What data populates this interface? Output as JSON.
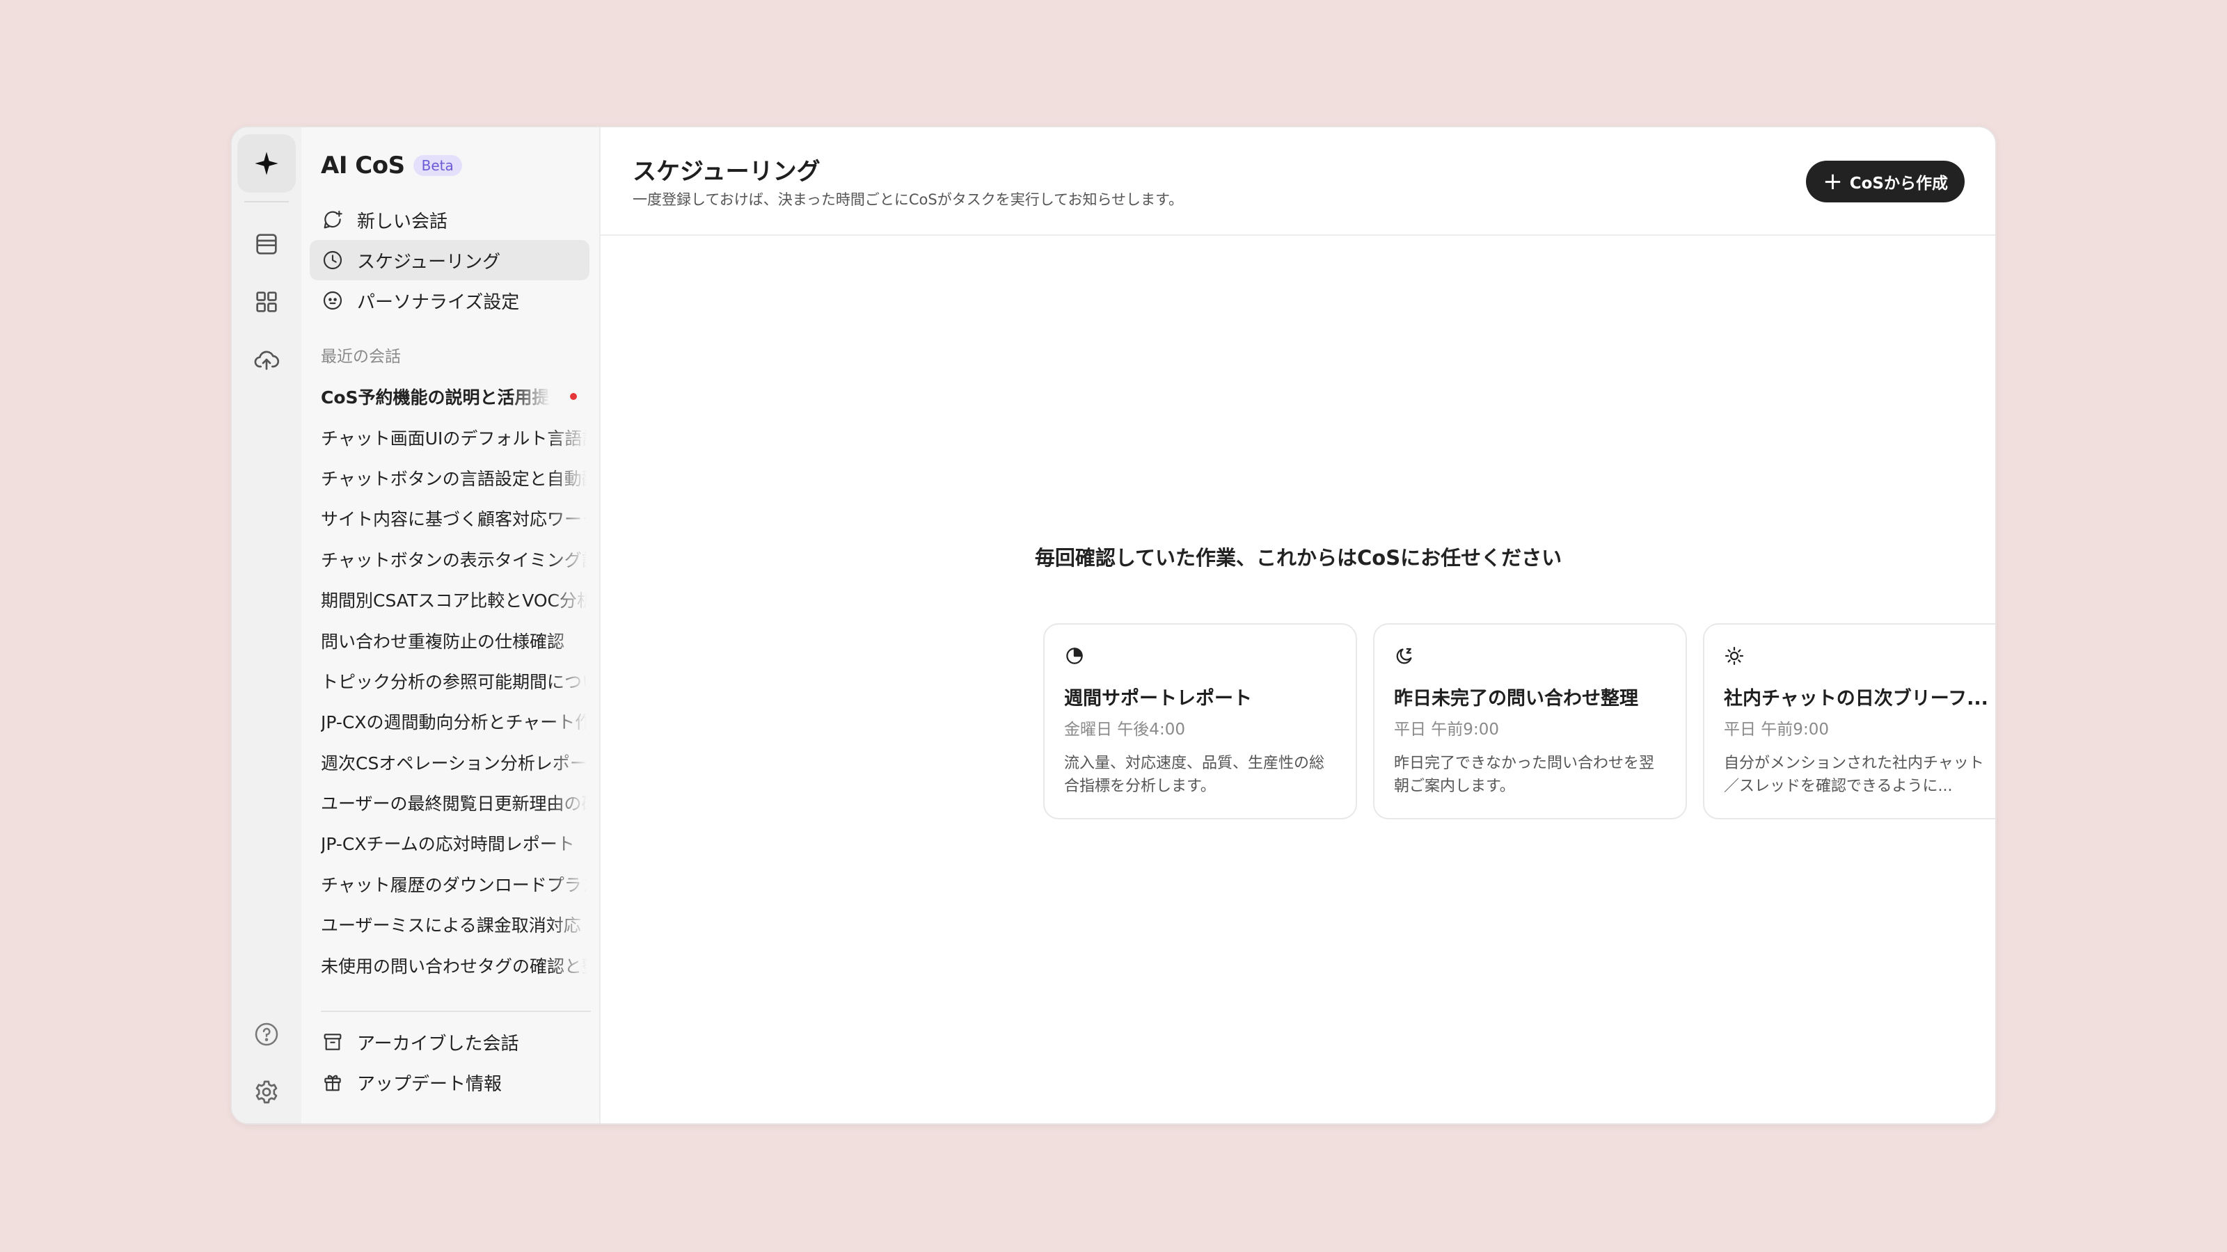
{
  "app": {
    "title": "AI CoS",
    "badge": "Beta"
  },
  "rail": {
    "icons": [
      "sparkle-icon",
      "inbox-icon",
      "grid-icon",
      "cloud-upload-icon",
      "help-icon",
      "settings-icon"
    ]
  },
  "sidebar": {
    "nav": [
      {
        "label": "新しい会話",
        "icon": "chat-plus-icon"
      },
      {
        "label": "スケジューリング",
        "icon": "clock-icon"
      },
      {
        "label": "パーソナライズ設定",
        "icon": "smiley-icon"
      }
    ],
    "recent_label": "最近の会話",
    "conversations": [
      "CoS予約機能の説明と活用提案",
      "チャット画面UIのデフォルト言語設定",
      "チャットボタンの言語設定と自動翻訳",
      "サイト内容に基づく顧客対応ワークフロー",
      "チャットボタンの表示タイミング設定",
      "期間別CSATスコア比較とVOC分析",
      "問い合わせ重複防止の仕様確認",
      "トピック分析の参照可能期間について",
      "JP-CXの週間動向分析とチャート作成",
      "週次CSオペレーション分析レポート",
      "ユーザーの最終閲覧日更新理由の確認",
      "JP-CXチームの応対時間レポート",
      "チャット履歴のダウンロードプラン",
      "ユーザーミスによる課金取消対応",
      "未使用の問い合わせタグの確認と整理"
    ],
    "footer": [
      {
        "label": "アーカイブした会話",
        "icon": "archive-icon"
      },
      {
        "label": "アップデート情報",
        "icon": "gift-icon"
      }
    ]
  },
  "main": {
    "title": "スケジューリング",
    "subtitle": "一度登録しておけば、決まった時間ごとにCoSがタスクを実行してお知らせします。",
    "create_button": "CoSから作成",
    "tagline": "毎回確認していた作業、これからはCoSにお任せください",
    "cards": [
      {
        "icon": "pie-chart-icon",
        "title": "週間サポートレポート",
        "schedule": "金曜日 午後4:00",
        "description": "流入量、対応速度、品質、生産性の総合指標を分析します。"
      },
      {
        "icon": "moon-icon",
        "title": "昨日未完了の問い合わせ整理",
        "schedule": "平日 午前9:00",
        "description": "昨日完了できなかった問い合わせを翌朝ご案内します。"
      },
      {
        "icon": "sun-icon",
        "title": "社内チャットの日次ブリーフ...",
        "schedule": "平日 午前9:00",
        "description": "自分がメンションされた社内チャット／スレッドを確認できるように..."
      }
    ]
  }
}
